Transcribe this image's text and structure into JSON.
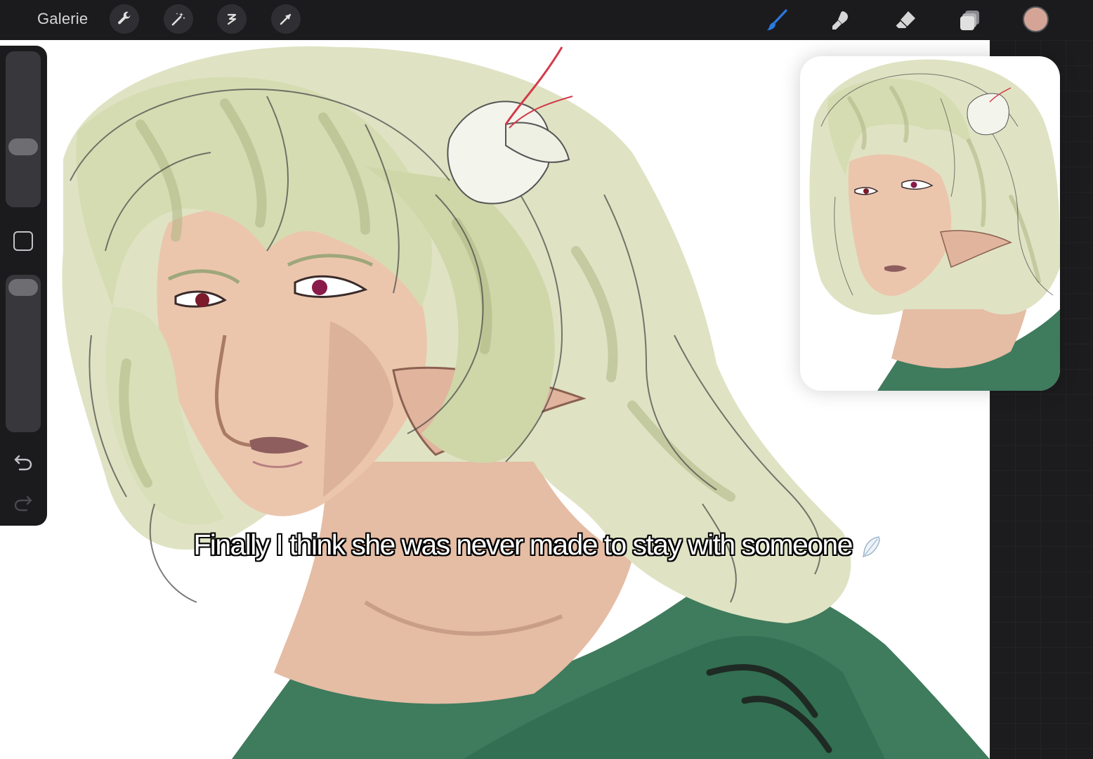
{
  "app": {
    "gallery_label": "Galerie"
  },
  "toolbar_left": [
    {
      "name": "wrench-icon",
      "label": "Actions"
    },
    {
      "name": "magic-wand-icon",
      "label": "Adjustments"
    },
    {
      "name": "selection-icon",
      "label": "Selection"
    },
    {
      "name": "arrow-cursor-icon",
      "label": "Transform"
    }
  ],
  "toolbar_right": [
    {
      "name": "brush-icon",
      "active": true
    },
    {
      "name": "smudge-icon",
      "active": false
    },
    {
      "name": "eraser-icon",
      "active": false
    },
    {
      "name": "layers-icon",
      "active": false
    }
  ],
  "current_color": "#d4a596",
  "accent_color": "#1a73e8",
  "sidebar": {
    "brush_size_level": 0.45,
    "opacity_level": 0.95,
    "undo_icon": "undo-icon",
    "redo_icon": "redo-icon"
  },
  "caption": {
    "text": "Finally I think she was never made to stay with someone"
  },
  "colors": {
    "hair": "#dfe3c3",
    "hair_shadow": "#b6bd8c",
    "skin": "#e8c1a9",
    "skin_shadow": "#b78a78",
    "clothing": "#3d7a5c",
    "line": "#3a3a3a"
  }
}
